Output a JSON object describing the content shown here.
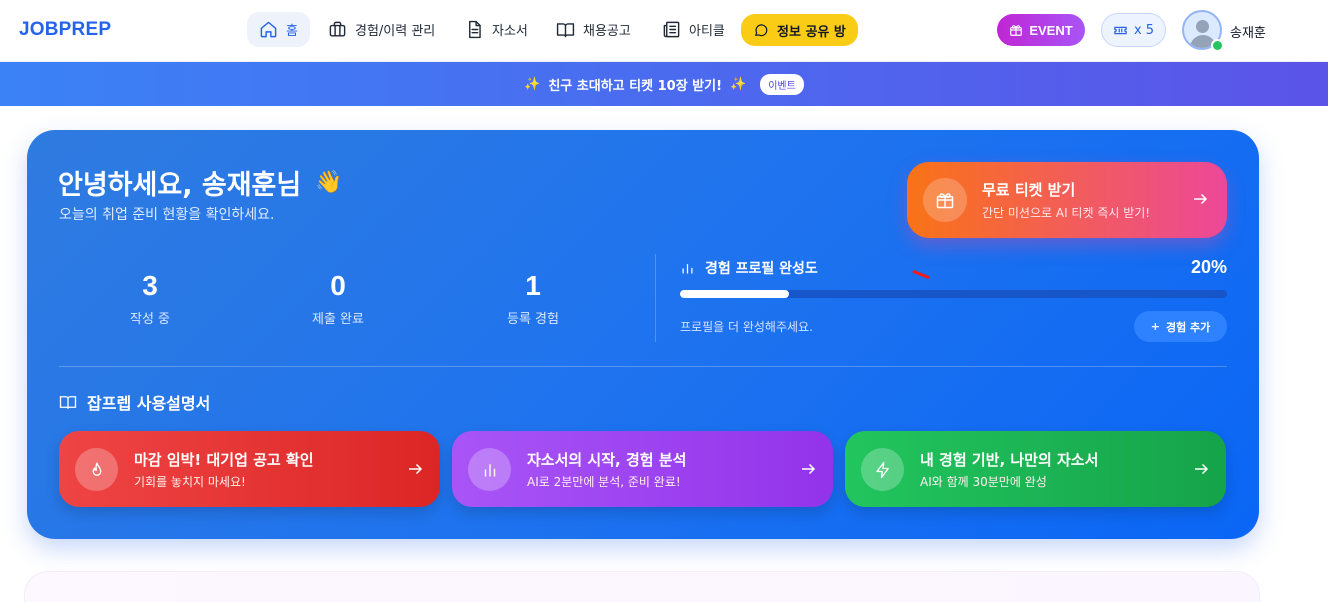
{
  "app": {
    "logo": "JOBPREP"
  },
  "nav": {
    "items": [
      {
        "label": "홈",
        "icon": "home-icon",
        "active": true
      },
      {
        "label": "경험/이력 관리",
        "icon": "briefcase-icon"
      },
      {
        "label": "자소서",
        "icon": "document-icon"
      },
      {
        "label": "채용공고",
        "icon": "book-icon"
      },
      {
        "label": "아티클",
        "icon": "newspaper-icon"
      }
    ],
    "share_room": "정보 공유 방",
    "event_label": "EVENT",
    "ticket_count": "x 5",
    "username": "송재훈"
  },
  "banner": {
    "text": "친구 초대하고 티켓 10장 받기!",
    "spark_left": "✨",
    "spark_right": "✨",
    "pill": "이벤트"
  },
  "hero": {
    "greeting": "안녕하세요, 송재훈님",
    "wave": "👋",
    "subtitle": "오늘의 취업 준비 현황을 확인하세요.",
    "free_ticket": {
      "title": "무료 티켓 받기",
      "subtitle": "간단 미션으로 AI 티켓 즉시 받기!"
    },
    "stats": [
      {
        "value": "3",
        "label": "작성 중"
      },
      {
        "value": "0",
        "label": "제출 완료"
      },
      {
        "value": "1",
        "label": "등록 경험"
      }
    ],
    "profile": {
      "title": "경험 프로필 완성도",
      "percent_label": "20%",
      "percent": 0.2,
      "hint": "프로필을 더 완성해주세요.",
      "add_button": "경험 추가",
      "add_symbol": "+"
    },
    "guide": {
      "title": "잡프렙 사용설명서",
      "cards": [
        {
          "title": "마감 임박! 대기업 공고 확인",
          "subtitle": "기회를 놓치지 마세요!",
          "icon": "flame-icon",
          "color": "#ef4444"
        },
        {
          "title": "자소서의 시작, 경험 분석",
          "subtitle": "AI로 2분만에 분석, 준비 완료!",
          "icon": "bar-chart-icon",
          "color": "#a855f7"
        },
        {
          "title": "내 경험 기반, 나만의 자소서",
          "subtitle": "AI와 함께 30분만에 완성",
          "icon": "lightning-icon",
          "color": "#22c55e"
        }
      ]
    }
  },
  "colors": {
    "accent": "#2563eb",
    "share_yellow": "#facc15",
    "event_purple": "#c026d3",
    "hero_blue": "#1f73ee"
  }
}
